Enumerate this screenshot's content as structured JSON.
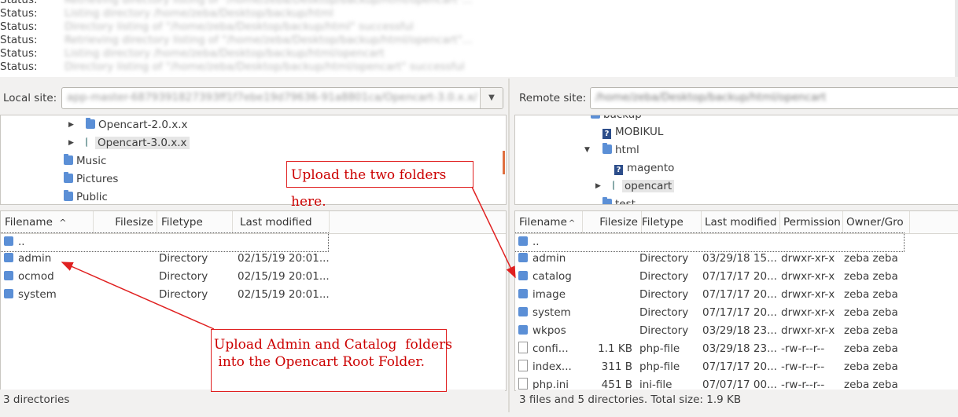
{
  "log": {
    "lines": [
      {
        "label": "Status:",
        "message": "Retrieving directory listing of \"/home/zeba/Desktop/backup/html/opencart\"..."
      },
      {
        "label": "Status:",
        "message": "Listing directory /home/zeba/Desktop/backup/html"
      },
      {
        "label": "Status:",
        "message": "Directory listing of \"/home/zeba/Desktop/backup/html\" successful"
      },
      {
        "label": "Status:",
        "message": "Retrieving directory listing of \"/home/zeba/Desktop/backup/html/opencart\"..."
      },
      {
        "label": "Status:",
        "message": "Listing directory /home/zeba/Desktop/backup/html/opencart"
      },
      {
        "label": "Status:",
        "message": "Directory listing of \"/home/zeba/Desktop/backup/html/opencart\" successful"
      }
    ]
  },
  "local": {
    "site_label": "Local site:",
    "site_value": "app-master-6879391827393ff1f7ebe19d79636-91a8801ca/Opencart-3.0.x.x/",
    "tree": [
      {
        "label": "Opencart-2.0.x.x",
        "expander": "▶"
      },
      {
        "label": "Opencart-3.0.x.x",
        "expander": "▶"
      },
      {
        "label": "Music"
      },
      {
        "label": "Pictures"
      },
      {
        "label": "Public"
      }
    ],
    "columns": [
      "Filename",
      "Filesize",
      "Filetype",
      "Last modified"
    ],
    "sort_indicator": "^",
    "parent": "..",
    "rows": [
      {
        "name": "admin",
        "size": "",
        "type": "Directory",
        "modified": "02/15/19 20:01..."
      },
      {
        "name": "ocmod",
        "size": "",
        "type": "Directory",
        "modified": "02/15/19 20:01..."
      },
      {
        "name": "system",
        "size": "",
        "type": "Directory",
        "modified": "02/15/19 20:01..."
      }
    ],
    "status": "3 directories"
  },
  "remote": {
    "site_label": "Remote site:",
    "site_value": "/home/zeba/Desktop/backup/html/opencart",
    "tree": [
      {
        "label": "backup"
      },
      {
        "label": "MOBIKUL"
      },
      {
        "label": "html",
        "expander": "▼"
      },
      {
        "label": "magento"
      },
      {
        "label": "opencart",
        "expander": "▶"
      },
      {
        "label": "test"
      }
    ],
    "columns": [
      "Filename",
      "Filesize",
      "Filetype",
      "Last modified",
      "Permission",
      "Owner/Gro"
    ],
    "sort_indicator": "^",
    "parent": "..",
    "rows": [
      {
        "name": "admin",
        "size": "",
        "type": "Directory",
        "modified": "03/29/18 15...",
        "perm": "drwxr-xr-x",
        "owner": "zeba zeba",
        "icon": "folder"
      },
      {
        "name": "catalog",
        "size": "",
        "type": "Directory",
        "modified": "07/17/17 20...",
        "perm": "drwxr-xr-x",
        "owner": "zeba zeba",
        "icon": "folder"
      },
      {
        "name": "image",
        "size": "",
        "type": "Directory",
        "modified": "07/17/17 20...",
        "perm": "drwxr-xr-x",
        "owner": "zeba zeba",
        "icon": "folder"
      },
      {
        "name": "system",
        "size": "",
        "type": "Directory",
        "modified": "07/17/17 20...",
        "perm": "drwxr-xr-x",
        "owner": "zeba zeba",
        "icon": "folder"
      },
      {
        "name": "wkpos",
        "size": "",
        "type": "Directory",
        "modified": "03/29/18 23...",
        "perm": "drwxr-xr-x",
        "owner": "zeba zeba",
        "icon": "folder"
      },
      {
        "name": "confi...",
        "size": "1.1 KB",
        "type": "php-file",
        "modified": "03/29/18 23...",
        "perm": "-rw-r--r--",
        "owner": "zeba zeba",
        "icon": "file"
      },
      {
        "name": "index...",
        "size": "311 B",
        "type": "php-file",
        "modified": "07/17/17 20...",
        "perm": "-rw-r--r--",
        "owner": "zeba zeba",
        "icon": "file"
      },
      {
        "name": "php.ini",
        "size": "451 B",
        "type": "ini-file",
        "modified": "07/07/17 00...",
        "perm": "-rw-r--r--",
        "owner": "zeba zeba",
        "icon": "file"
      }
    ],
    "status": "3 files and 5 directories. Total size: 1.9 KB"
  },
  "annotations": {
    "upload_here": "Upload the two folders here.",
    "upload_admin_line1": "Upload Admin and Catalog  folders",
    "upload_admin_line2": " into the Opencart Root Folder.",
    "color": "#e02020"
  }
}
